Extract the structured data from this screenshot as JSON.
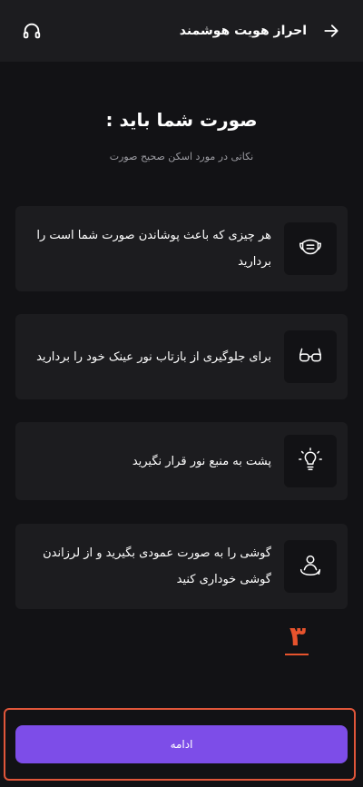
{
  "header": {
    "title": "احراز هویت هوشمند",
    "back_icon": "arrow-right-icon",
    "support_icon": "headset-icon"
  },
  "main": {
    "title": "صورت شما باید :",
    "subtitle": "نکاتی در مورد اسکن صحیح صورت",
    "tips": [
      {
        "icon": "face-mask-icon",
        "text": "هر چیزی که باعث پوشاندن صورت شما است را بردارید"
      },
      {
        "icon": "glasses-icon",
        "text": "برای جلوگیری از بازتاب نور عینک خود را بردارید"
      },
      {
        "icon": "lightbulb-icon",
        "text": "پشت به منبع نور قرار نگیرید"
      },
      {
        "icon": "phone-rotate-user-icon",
        "text": "گوشی را به صورت عمودی بگیرید و از لرزاندن گوشی خوداری کنید"
      }
    ]
  },
  "annotation": {
    "label": "۳",
    "color": "#e6532d"
  },
  "footer": {
    "continue_label": "ادامه",
    "accent": "#7d4de8"
  }
}
